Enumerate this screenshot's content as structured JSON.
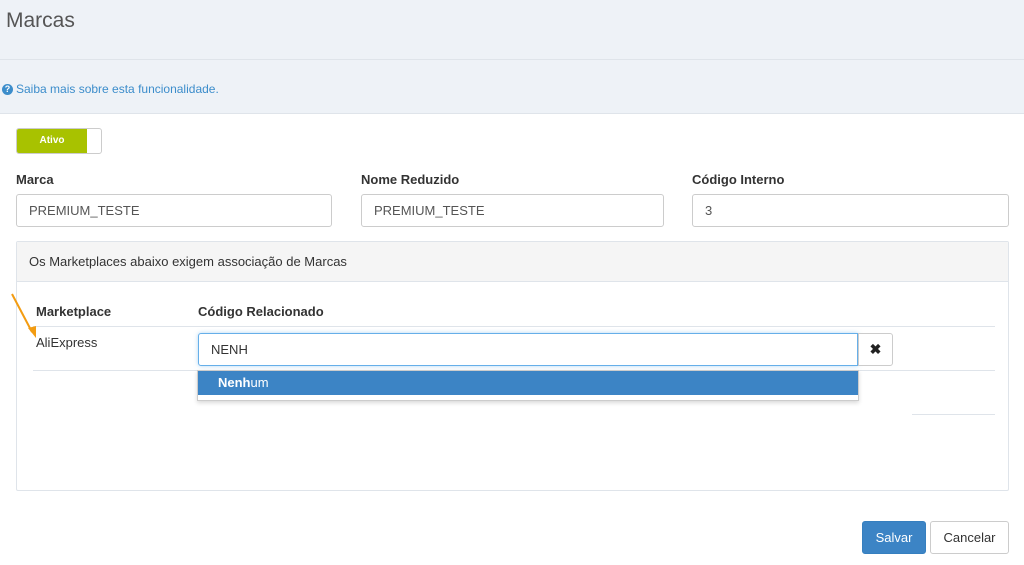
{
  "page": {
    "title": "Marcas"
  },
  "help": {
    "text": "Saiba mais sobre esta funcionalidade.",
    "icon": "question-circle-icon"
  },
  "status_toggle": {
    "label": "Ativo",
    "color": "#a8c200"
  },
  "form": {
    "brand_label": "Marca",
    "brand_value": "PREMIUM_TESTE",
    "short_name_label": "Nome Reduzido",
    "short_name_value": "PREMIUM_TESTE",
    "internal_code_label": "Código Interno",
    "internal_code_value": "3"
  },
  "marketplaces": {
    "notice": "Os Marketplaces abaixo exigem associação de Marcas",
    "col_marketplace": "Marketplace",
    "col_code": "Código Relacionado",
    "rows": [
      {
        "marketplace": "AliExpress",
        "code_input": "NENH"
      }
    ],
    "dropdown": {
      "match": "Nenh",
      "rest": "um"
    }
  },
  "actions": {
    "save_label": "Salvar",
    "cancel_label": "Cancelar",
    "save_color": "#3c84c5"
  }
}
